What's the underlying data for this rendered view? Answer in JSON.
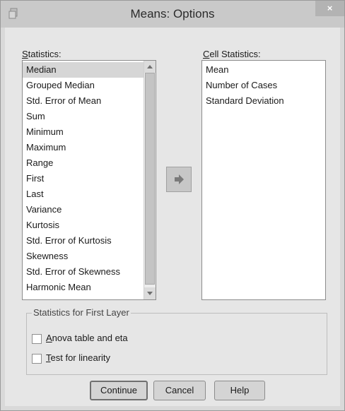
{
  "window": {
    "title": "Means: Options",
    "close_glyph": "×"
  },
  "statistics": {
    "label_underlined": "S",
    "label_rest": "tatistics:",
    "items": [
      "Median",
      "Grouped Median",
      "Std. Error of Mean",
      "Sum",
      "Minimum",
      "Maximum",
      "Range",
      "First",
      "Last",
      "Variance",
      "Kurtosis",
      "Std. Error of Kurtosis",
      "Skewness",
      "Std. Error of Skewness",
      "Harmonic Mean"
    ],
    "selected": "Median"
  },
  "cell_statistics": {
    "label_underlined": "C",
    "label_rest": "ell Statistics:",
    "items": [
      "Mean",
      "Number of Cases",
      "Standard Deviation"
    ]
  },
  "move_button": {
    "icon": "right-arrow-icon"
  },
  "first_layer": {
    "title": "Statistics for First Layer",
    "anova": {
      "underlined": "A",
      "rest": "nova table and eta",
      "checked": false
    },
    "linearity": {
      "underlined": "T",
      "rest": "est for linearity",
      "checked": false
    }
  },
  "buttons": {
    "continue": "Continue",
    "cancel": "Cancel",
    "help": "Help"
  },
  "colors": {
    "dialog_bg": "#e6e6e6",
    "selection": "#d6d6d6",
    "arrow": "#7a7a7a"
  }
}
